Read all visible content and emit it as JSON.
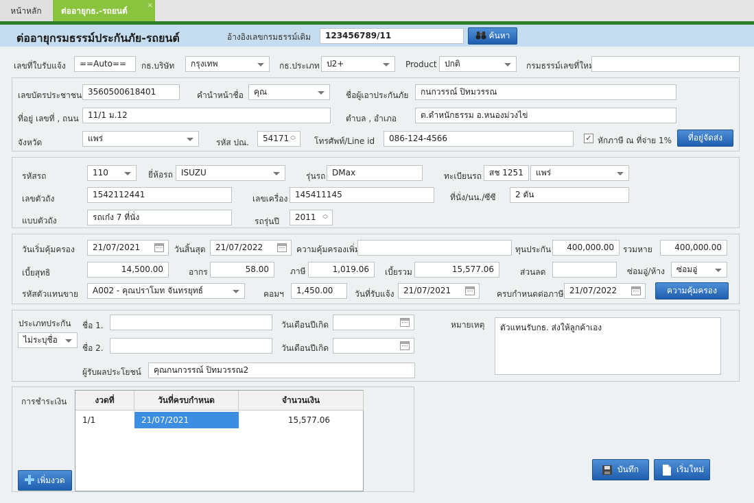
{
  "tabs": [
    {
      "label": "หน้าหลัก"
    },
    {
      "label": "ต่ออายุกธ.-รถยนต์",
      "close": "×"
    }
  ],
  "header": {
    "title": "ต่ออายุกรมธรรม์ประกันภัย-รถยนต์",
    "ref_label": "อ้างอิงเลขกรมธรรม์เดิม",
    "ref_value": "123456789/11",
    "search_label": "ค้นหา"
  },
  "row1": {
    "receipt_label": "เลขที่ใบรับแจ้ง",
    "receipt_value": "==Auto==",
    "company_label": "กธ.บริษัท",
    "company_value": "กรุงเทพ",
    "type_label": "กธ.ประเภท",
    "type_value": "ป2+",
    "product_label": "Product",
    "product_value": "ปกติ",
    "newpolicy_label": "กรมธรรม์เลขที่ใหม่",
    "newpolicy_value": ""
  },
  "insured": {
    "id_label": "เลขบัตรประชาชน",
    "id_value": "3560500618401",
    "prefix_label": "คำนำหน้าชื่อ",
    "prefix_value": "คุณ",
    "name_label": "ชื่อผู้เอาประกันภัย",
    "name_value": "กนกวรรณ์  ปิทมวรรณ",
    "addr_label": "ที่อยู่ เลขที่ , ถนน",
    "addr_value": "11/1 ม.12",
    "subdistrict_label": "ตำบล , อำเภอ",
    "subdistrict_value": "ต.ดำหนักธรรม อ.หนองม่วงไข่",
    "province_label": "จังหวัด",
    "province_value": "แพร่",
    "postal_label": "รหัส ปณ.",
    "postal_value": "54171",
    "phone_label": "โทรศัพท์/Line id",
    "phone_value": "086-124-4566",
    "tax_label": "หักภาษี ณ ที่จ่าย 1%",
    "tax_checked": "✓",
    "delivery_label": "ที่อยู่จัดส่ง"
  },
  "car": {
    "code_label": "รหัสรถ",
    "code_value": "110",
    "brand_label": "ยี่ห้อรถ",
    "brand_value": "ISUZU",
    "model_label": "รุ่นรถ",
    "model_value": "DMax",
    "plate_label": "ทะเบียนรถ",
    "plate_value": "สช 1251",
    "plate_province": "แพร่",
    "chassis_label": "เลขตัวถัง",
    "chassis_value": "1542112441",
    "engine_label": "เลขเครื่อง",
    "engine_value": "145411145",
    "seat_label": "ที่นั่ง/นน./ซีซี",
    "seat_value": "2 ตัน",
    "body_label": "แบบตัวถัง",
    "body_value": "รถเก๋ง 7 ที่นั่ง",
    "year_label": "รถรุ่นปี",
    "year_value": "2011"
  },
  "coverage": {
    "start_label": "วันเริ่มคุ้มครอง",
    "start_value": "21/07/2021",
    "end_label": "วันสิ้นสุด",
    "end_value": "21/07/2022",
    "extra_label": "ความคุ้มครองเพิ่ม",
    "extra_value": "",
    "sum_label": "ทุนประกัน",
    "sum_value": "400,000.00",
    "loss_label": "รวมหาย",
    "loss_value": "400,000.00",
    "net_label": "เบี้ยสุทธิ",
    "net_value": "14,500.00",
    "stamp_label": "อากร",
    "stamp_value": "58.00",
    "tax_label": "ภาษี",
    "tax_value": "1,019.06",
    "total_label": "เบี้ยรวม",
    "total_value": "15,577.06",
    "discount_label": "ส่วนลด",
    "discount_value": "",
    "repair_label": "ซ่อมอู่/ห้าง",
    "repair_value": "ซ่อมอู่",
    "agent_label": "รหัสตัวแทนขาย",
    "agent_value": "A002 - คุณปราโมท จันทรยุทธ์",
    "comm_label": "คอมฯ",
    "comm_value": "1,450.00",
    "notify_label": "วันที่รับแจ้ง",
    "notify_value": "21/07/2021",
    "taxdue_label": "ครบกำหนดต่อภาษี",
    "taxdue_value": "21/07/2022",
    "coverage_btn": "ความคุ้มครอง"
  },
  "beneficiary": {
    "type_label": "ประเภทประกัน",
    "type_value": "ไม่ระบุชื่อ",
    "name1_label": "ชื่อ 1.",
    "name1_value": "",
    "dob1_label": "วันเดือนปีเกิด",
    "name2_label": "ชื่อ 2.",
    "name2_value": "",
    "dob2_label": "วันเดือนปีเกิด",
    "benef_label": "ผู้รับผลประโยชน์",
    "benef_value": "คุณกนกวรรณ์  ปิทมวรรณ2",
    "remark_label": "หมายเหตุ",
    "remark_value": "ตัวแทนรับกธ. ส่งให้ลูกค้าเอง"
  },
  "payment": {
    "label": "การชำระเงิน",
    "columns": [
      "งวดที่",
      "วันที่ครบกำหนด",
      "จำนวนเงิน"
    ],
    "rows": [
      {
        "no": "1/1",
        "date": "21/07/2021",
        "amount": "15,577.06"
      }
    ],
    "add_label": "เพิ่มงวด"
  },
  "actions": {
    "save_label": "บันทึก",
    "new_label": "เริ่มใหม่"
  }
}
